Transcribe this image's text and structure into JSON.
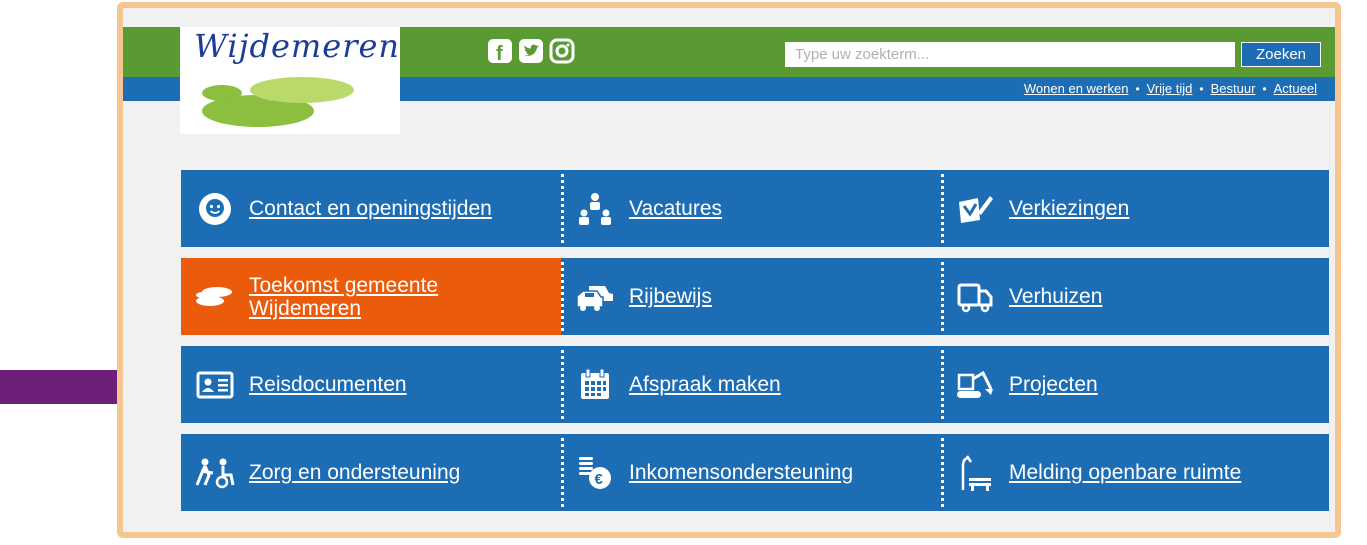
{
  "header": {
    "logo_text": "Wijdemeren",
    "social": [
      {
        "name": "facebook-icon",
        "glyph": "f"
      },
      {
        "name": "twitter-icon",
        "glyph": "t"
      },
      {
        "name": "instagram-icon",
        "glyph": "◎"
      }
    ],
    "search": {
      "placeholder": "Type uw zoekterm...",
      "value": "",
      "button_label": "Zoeken"
    },
    "nav": [
      "Wonen en werken",
      "Vrije tijd",
      "Bestuur",
      "Actueel"
    ],
    "nav_separator": "•"
  },
  "tiles": [
    {
      "label": "Contact en openingstijden",
      "icon": "contact-person-icon"
    },
    {
      "label": "Vacatures",
      "icon": "vacancies-people-icon"
    },
    {
      "label": "Verkiezingen",
      "icon": "elections-icon"
    },
    {
      "label": "Toekomst gemeente Wijdemeren",
      "icon": "lily-pad-icon"
    },
    {
      "label": "Rijbewijs",
      "icon": "cars-icon"
    },
    {
      "label": "Verhuizen",
      "icon": "moving-truck-icon"
    },
    {
      "label": "Reisdocumenten",
      "icon": "id-card-icon"
    },
    {
      "label": "Afspraak maken",
      "icon": "calendar-icon"
    },
    {
      "label": "Projecten",
      "icon": "excavator-icon"
    },
    {
      "label": "Zorg en ondersteuning",
      "icon": "care-icon"
    },
    {
      "label": "Inkomensondersteuning",
      "icon": "euro-coins-icon"
    },
    {
      "label": "Melding openbare ruimte",
      "icon": "street-bench-icon"
    }
  ],
  "colors": {
    "green": "#5a9a32",
    "blue": "#1d6db5",
    "orange": "#ea5b0c",
    "frame": "#f5c690",
    "arrow": "#6d2077"
  }
}
